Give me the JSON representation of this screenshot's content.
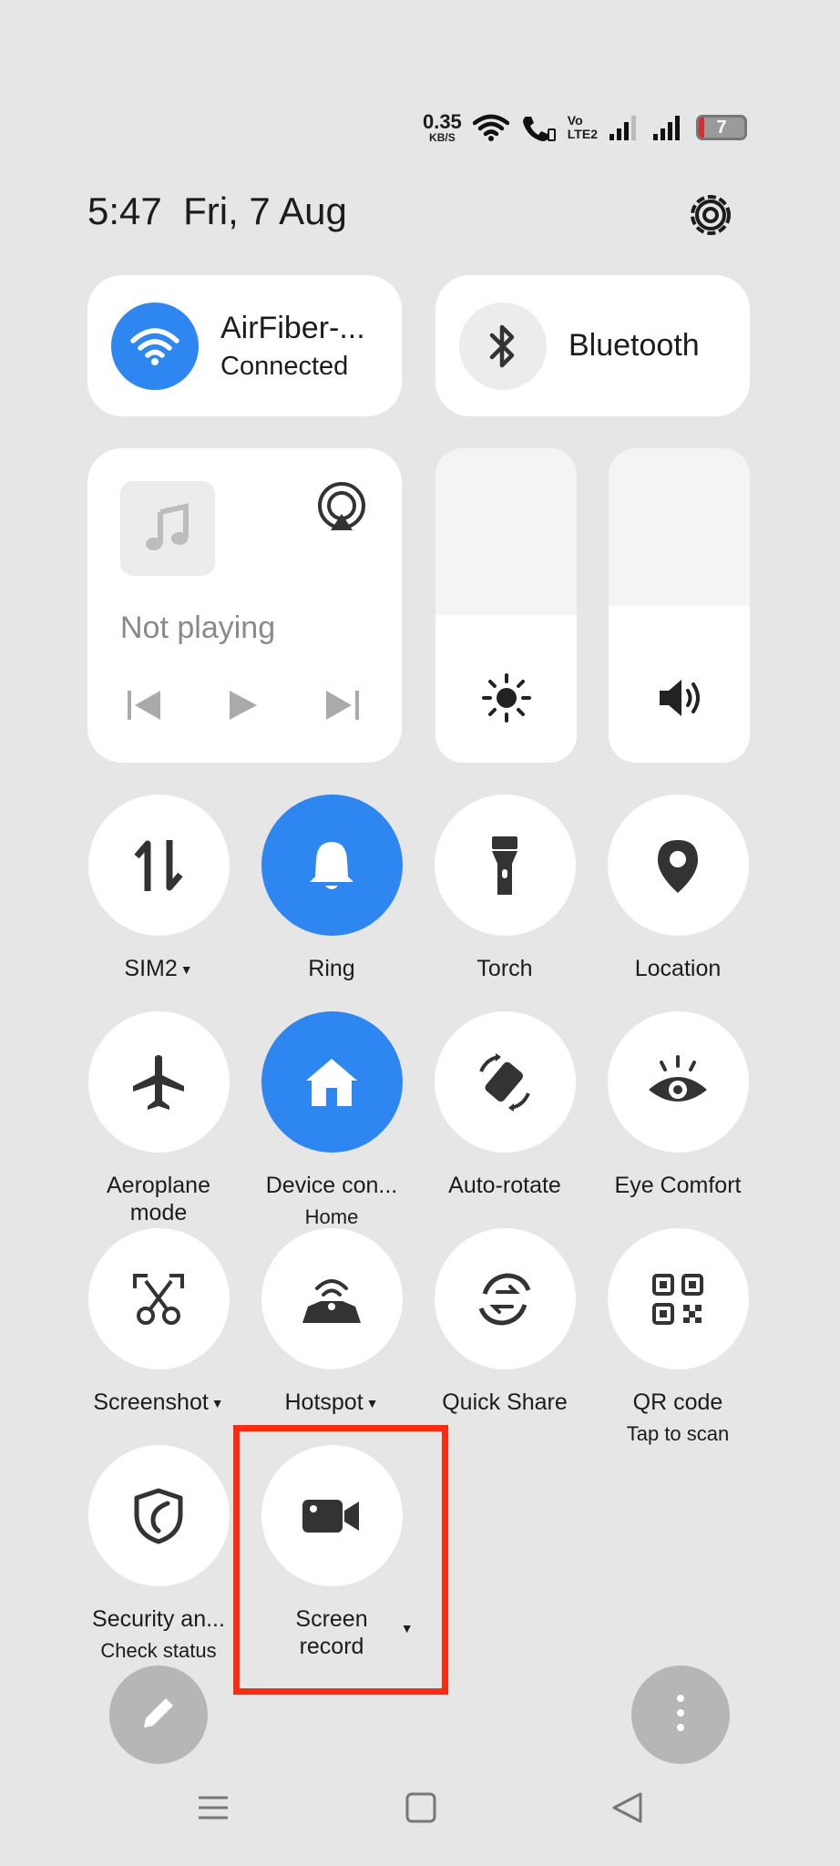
{
  "status_bar": {
    "net_speed_value": "0.35",
    "net_speed_unit": "KB/S",
    "volte_top": "Vo",
    "volte_bottom": "LTE2",
    "battery_level": "7",
    "icons": [
      "wifi-icon",
      "wifi-calling-icon",
      "volte-icon",
      "signal-sim1-icon",
      "signal-sim2-icon",
      "battery-icon"
    ]
  },
  "header": {
    "time": "5:47",
    "date": "Fri, 7 Aug",
    "settings_icon": "gear-icon"
  },
  "wifi_card": {
    "title": "AirFiber-...",
    "status": "Connected",
    "icon": "wifi-icon"
  },
  "bluetooth_card": {
    "title": "Bluetooth",
    "icon": "bluetooth-icon"
  },
  "media": {
    "status": "Not playing",
    "controls": [
      "previous-icon",
      "play-icon",
      "next-icon"
    ],
    "output_icon": "cast-icon"
  },
  "sliders": {
    "brightness_level": 0.47,
    "volume_level": 0.5
  },
  "tiles": [
    {
      "label": "SIM2",
      "caret": "▼",
      "icon": "mobile-data-icon",
      "active": false
    },
    {
      "label": "Ring",
      "icon": "bell-icon",
      "active": true
    },
    {
      "label": "Torch",
      "icon": "flashlight-icon",
      "active": false
    },
    {
      "label": "Location",
      "icon": "location-pin-icon",
      "active": false
    },
    {
      "label": "Aeroplane mode",
      "line1": "Aeroplane",
      "line2": "mode",
      "icon": "airplane-icon",
      "active": false
    },
    {
      "label": "Device con...",
      "sub": "Home",
      "icon": "home-icon",
      "active": true
    },
    {
      "label": "Auto-rotate",
      "icon": "rotate-icon",
      "active": false
    },
    {
      "label": "Eye Comfort",
      "icon": "eye-icon",
      "active": false
    },
    {
      "label": "Screenshot",
      "caret": "▼",
      "icon": "scissors-icon",
      "active": false
    },
    {
      "label": "Hotspot",
      "caret": "▼",
      "icon": "hotspot-icon",
      "active": false
    },
    {
      "label": "Quick Share",
      "icon": "quick-share-icon",
      "active": false
    },
    {
      "label": "QR code",
      "sub": "Tap to scan",
      "icon": "qr-code-icon",
      "active": false
    },
    {
      "label": "Security an...",
      "sub": "Check status",
      "icon": "shield-icon",
      "active": false
    },
    {
      "label": "Screen record",
      "line1": "Screen",
      "line2": "record",
      "caret": "▼",
      "icon": "video-camera-icon",
      "active": false
    }
  ],
  "bottom_actions": {
    "edit_icon": "pencil-icon",
    "more_icon": "more-vertical-icon"
  },
  "nav_bar": [
    "menu-icon",
    "home-square-icon",
    "back-triangle-icon"
  ],
  "colors": {
    "accent": "#2e86f0",
    "background": "#e6e6e6",
    "highlight": "#ff2a12"
  }
}
